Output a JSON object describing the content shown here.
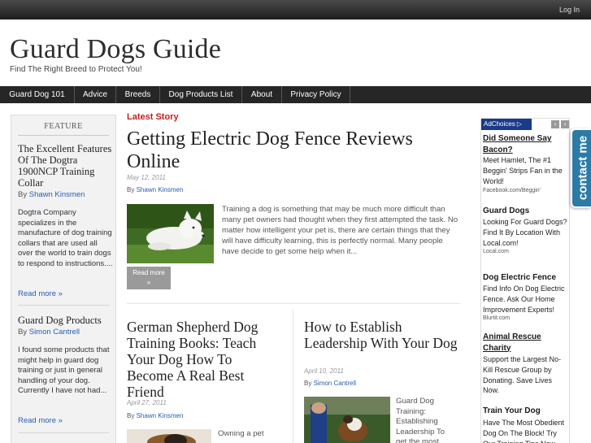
{
  "topbar": {
    "login": "Log In"
  },
  "header": {
    "title": "Guard Dogs Guide",
    "tagline": "Find The Right Breed to Protect You!"
  },
  "nav": [
    "Guard Dog 101",
    "Advice",
    "Breeds",
    "Dog Products List",
    "About",
    "Privacy Policy"
  ],
  "sidebar": {
    "heading": "FEATURE",
    "posts": [
      {
        "title": "The Excellent Features Of The Dogtra 1900NCP Training Collar",
        "by": "By",
        "author": "Shawn Kinsmen",
        "excerpt": "Dogtra Company specializes in the manufacture of dog training collars that are used all over the world to train dogs to respond to instructions....",
        "more": "Read more »"
      },
      {
        "title": "Guard Dog Products",
        "by": "By",
        "author": "Simon Cantrell",
        "excerpt": "I found some products that might help in guard dog training or just in general handling of your dog. Currently I have not had...",
        "more": "Read more »"
      }
    ]
  },
  "main": {
    "latest_label": "Latest Story",
    "featured": {
      "title": "Getting Electric Dog Fence Reviews Online",
      "date": "May 12, 2011",
      "by": "By",
      "author": "Shawn Kinsmen",
      "excerpt": "Training a dog is something that may be much more difficult than many pet owners had thought when they first attempted the task. No matter how intelligent your pet is, there are certain things that they will have difficulty learning, this is perfectly normal. Many people have decide to get some help when it...",
      "read_more": "Read more",
      "read_more_arrow": "»"
    },
    "posts": [
      {
        "title": "German Shepherd Dog Training Books: Teach Your Dog How To Become A Real Best Friend",
        "date": "April 27, 2011",
        "by": "By",
        "author": "Shawn Kinsmen",
        "excerpt": "Owning a pet"
      },
      {
        "title": "How to Establish Leadership With Your Dog",
        "date": "April 10, 2011",
        "by": "By",
        "author": "Simon Cantrell",
        "excerpt": "Guard Dog Training: Establishing Leadership To get the most"
      }
    ]
  },
  "ads": {
    "adchoices": "AdChoices",
    "items": [
      {
        "title": "Did Someone Say Bacon?",
        "body": "Meet Hamlet, The #1 Beggin' Strips Fan in the World!",
        "url": "Facebook.com/Beggin'"
      },
      {
        "title": "Guard Dogs",
        "body": "Looking For Guard Dogs? Find It By Location With Local.com!",
        "url": "Local.com"
      },
      {
        "title": "Dog Electric Fence",
        "body": "Find Info On Dog Electric Fence. Ask Our Home Improvement Experts!",
        "url": "Blurtit.com"
      },
      {
        "title": "Animal Rescue Charity",
        "body": "Support the Largest No-Kill Rescue Group by Donating. Save Lives Now.",
        "url": ""
      },
      {
        "title": "Train Your Dog",
        "body": "Have The Most Obedient Dog On The Block! Try Our Training Tips Now",
        "url": ""
      }
    ]
  },
  "contact_tab": "contact me",
  "colors": {
    "nav_bg": "#262626",
    "accent_red": "#c8201c",
    "link_blue": "#2a5db0",
    "contact_blue": "#2b7ba6"
  }
}
